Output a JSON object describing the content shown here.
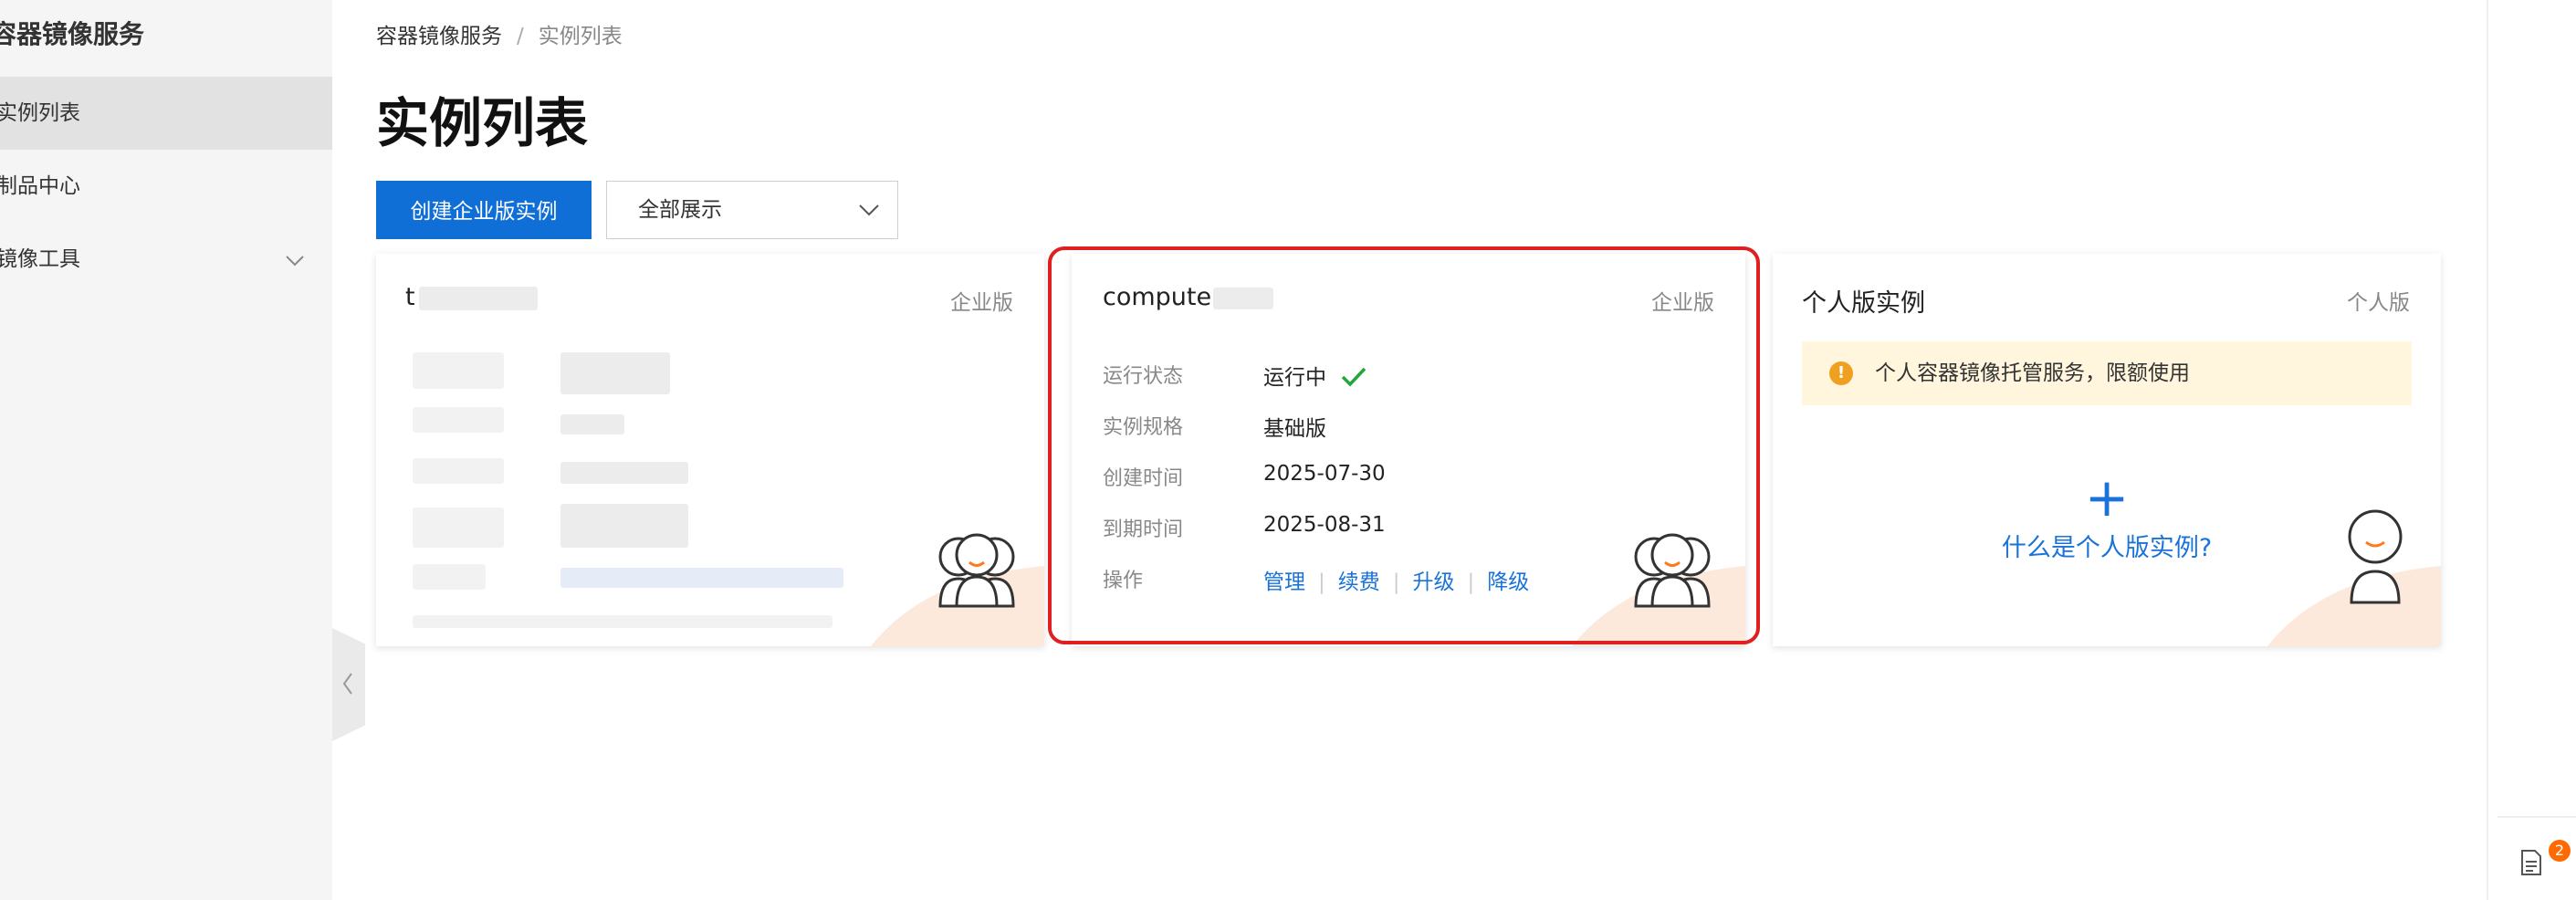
{
  "sidebar": {
    "title": "容器镜像服务",
    "items": [
      {
        "label": "实例列表"
      },
      {
        "label": "制品中心"
      },
      {
        "label": "镜像工具"
      }
    ]
  },
  "breadcrumb": {
    "root": "容器镜像服务",
    "separator": "/",
    "current": "实例列表"
  },
  "page": {
    "title": "实例列表"
  },
  "toolbar": {
    "create_label": "创建企业版实例",
    "filter_value": "全部展示"
  },
  "cards": [
    {
      "name": "t",
      "edition": "企业版",
      "redacted": true
    },
    {
      "name": "compute",
      "edition": "企业版",
      "rows": [
        {
          "label": "运行状态",
          "value": "运行中"
        },
        {
          "label": "实例规格",
          "value": "基础版"
        },
        {
          "label": "创建时间",
          "value": "2025-07-30"
        },
        {
          "label": "到期时间",
          "value": "2025-08-31"
        }
      ],
      "ops_label": "操作",
      "ops": [
        "管理",
        "续费",
        "升级",
        "降级"
      ]
    },
    {
      "name": "个人版实例",
      "edition": "个人版",
      "notice": "个人容器镜像托管服务，限额使用",
      "link": "什么是个人版实例?"
    }
  ],
  "colors": {
    "primary": "#0f6fd6",
    "link": "#1a73d8",
    "highlight": "#e02020",
    "success": "#22a83a",
    "warning": "#f0a020",
    "badge": "#ff6a00"
  },
  "notifications": {
    "count": "2"
  }
}
